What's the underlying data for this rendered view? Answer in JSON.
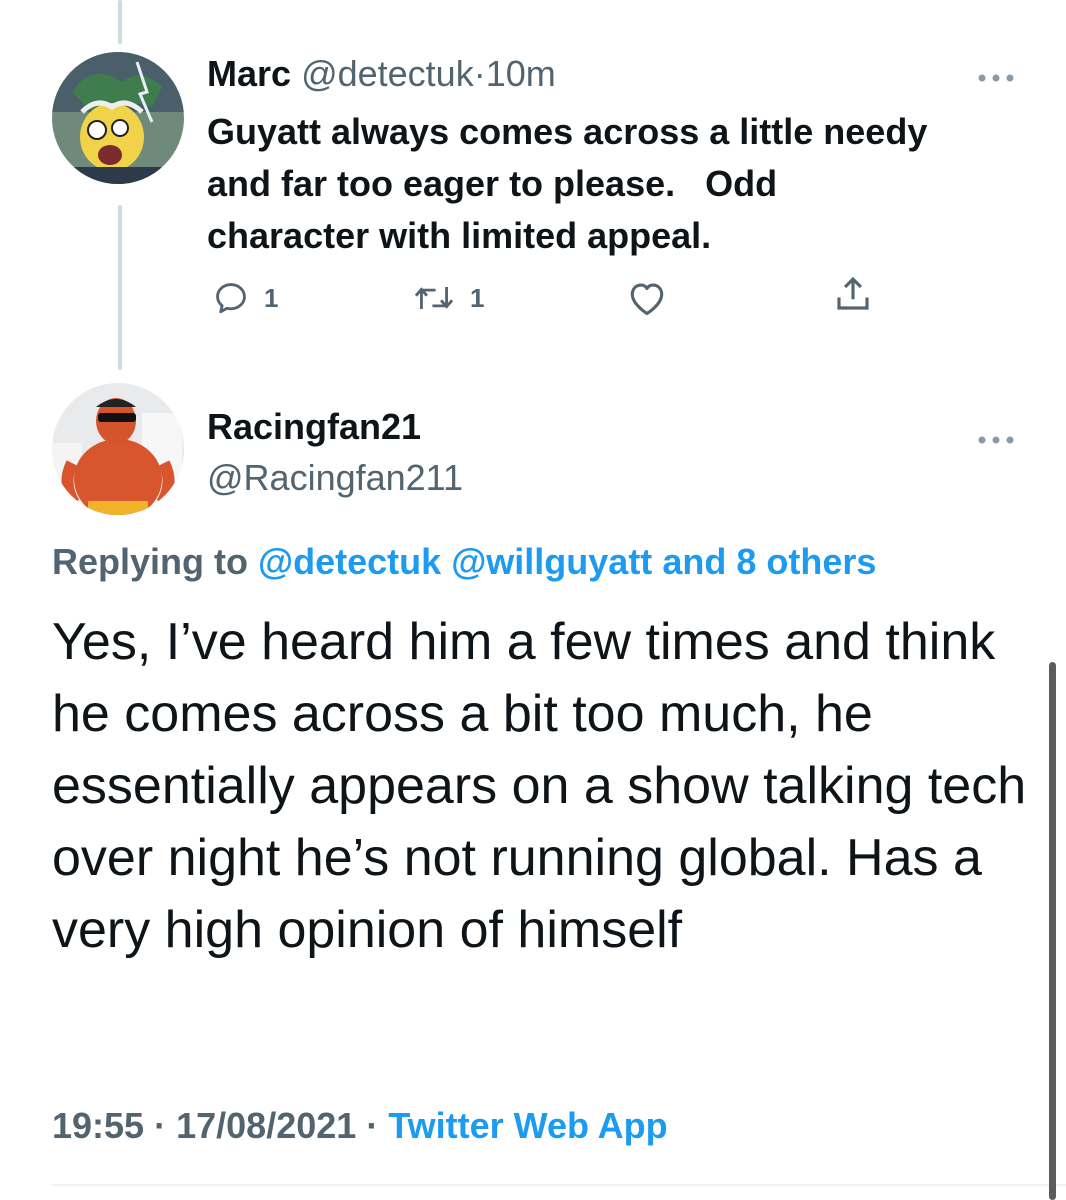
{
  "tweet1": {
    "display_name": "Marc",
    "handle": "@detectuk",
    "separator": "·",
    "time": "10m",
    "text": "Guyatt always comes across a little needy\nand far too eager to please.   Odd\ncharacter with limited appeal.",
    "more_icon": "more-horizontal-icon",
    "actions": {
      "reply_count": "1",
      "retweet_count": "1",
      "like_count": "",
      "share_count": ""
    }
  },
  "tweet2": {
    "display_name": "Racingfan21",
    "handle": "@Racingfan211",
    "more_icon": "more-horizontal-icon",
    "replying": {
      "prefix": "Replying to",
      "mention1": "@detectuk",
      "mention2": "@willguyatt",
      "others": "and 8 others"
    },
    "text": "Yes, I’ve heard him a few times and think he comes across a bit too much, he essentially appears on a show talking tech over night he’s not running global. Has a very high opinion of himself",
    "meta": {
      "time": "19:55",
      "sep1": "·",
      "date": "17/08/2021",
      "sep2": "·",
      "source": "Twitter Web App"
    }
  },
  "colors": {
    "text": "#0f1419",
    "muted": "#536471",
    "link": "#1d9bf0",
    "thread_line": "#cfd9de"
  }
}
